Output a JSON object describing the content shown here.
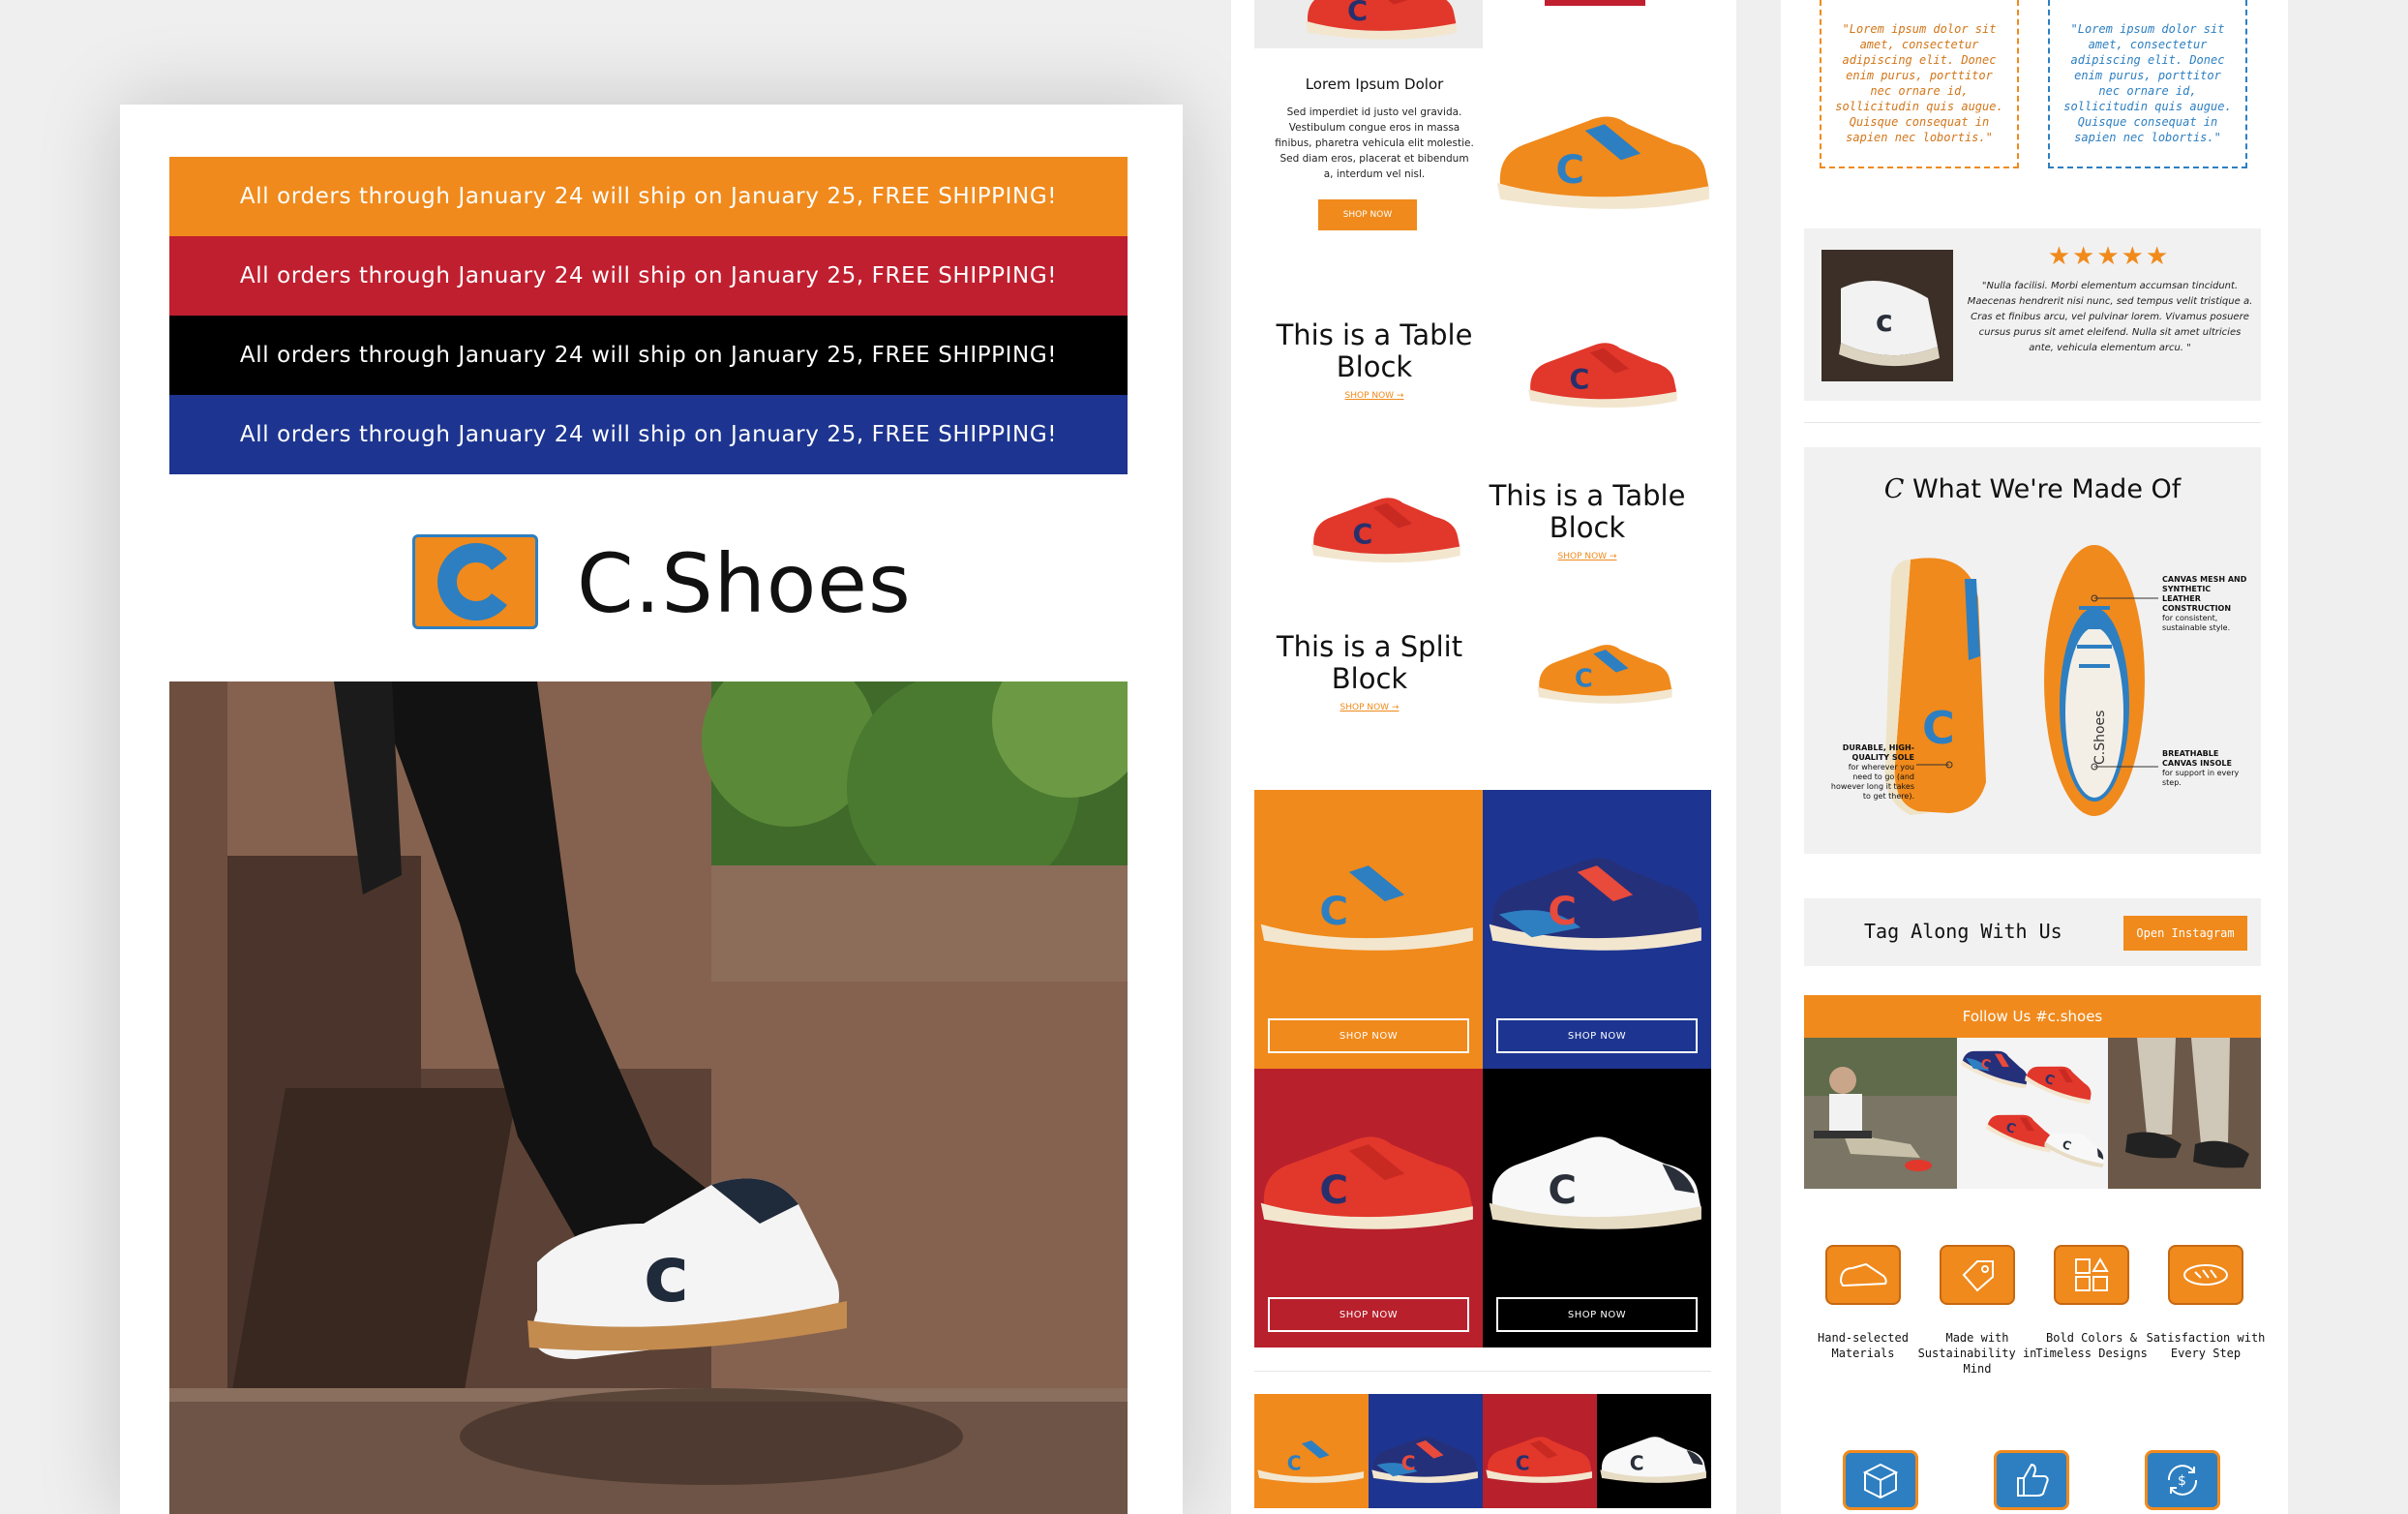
{
  "colors": {
    "orange": "#f08a1c",
    "red": "#c01f2f",
    "black": "#000000",
    "blue": "#1d3590",
    "logo_blue": "#2d7fc1",
    "background": "#efefef"
  },
  "main": {
    "banners": [
      {
        "text": "All orders through January 24 will ship on January 25, FREE SHIPPING!",
        "color": "#f08a1c"
      },
      {
        "text": "All orders through January 24 will ship on January 25, FREE SHIPPING!",
        "color": "#c01f2f"
      },
      {
        "text": "All orders through January 24 will ship on January 25, FREE SHIPPING!",
        "color": "#000000"
      },
      {
        "text": "All orders through January 24 will ship on January 25, FREE SHIPPING!",
        "color": "#1d3590"
      }
    ],
    "logo": {
      "icon": "c-logo-icon",
      "text": "C.Shoes"
    },
    "hero": {
      "icon": "sneaker-photo"
    }
  },
  "middle": {
    "product": {
      "title": "Lorem Ipsum Dolor",
      "body": "Sed imperdiet id justo vel gravida. Vestibulum congue eros in massa finibus, pharetra vehicula elit molestie. Sed diam eros, placerat et bibendum a, interdum vel nisl.",
      "button": "SHOP NOW"
    },
    "table_blocks": [
      {
        "title": "This is a Table Block",
        "link": "SHOP NOW →"
      },
      {
        "title": "This is a Table Block",
        "link": "SHOP NOW →"
      },
      {
        "title": "This is a Split Block",
        "link": "SHOP NOW →"
      }
    ],
    "grid_buttons": [
      "SHOP NOW",
      "SHOP NOW",
      "SHOP NOW",
      "SHOP NOW"
    ]
  },
  "right": {
    "quotes": [
      "\"Lorem ipsum dolor sit amet, consectetur adipiscing elit. Donec enim purus, porttitor nec ornare id, sollicitudin quis augue. Quisque consequat in sapien nec lobortis.\"",
      "\"Lorem ipsum dolor sit amet, consectetur adipiscing elit. Donec enim purus, porttitor nec ornare id, sollicitudin quis augue. Quisque consequat in sapien nec lobortis.\""
    ],
    "review": {
      "stars": "★★★★★",
      "rating": 5,
      "text": "\"Nulla facilisi. Morbi elementum accumsan tincidunt. Maecenas hendrerit nisi nunc, sed tempus velit tristique a. Cras et finibus arcu, vel pulvinar lorem. Vivamus posuere cursus purus sit amet eleifend. Nulla sit amet ultricies ante, vehicula elementum arcu. \""
    },
    "made_of": {
      "title_letter": "C",
      "title": "What We're Made Of",
      "annotations": [
        {
          "head": "CANVAS MESH AND SYNTHETIC LEATHER CONSTRUCTION",
          "body": "for consistent, sustainable style."
        },
        {
          "head": "DURABLE, HIGH-QUALITY SOLE",
          "body": "for wherever you need to go (and however long it takes to get there)."
        },
        {
          "head": "BREATHABLE CANVAS INSOLE",
          "body": "for support in every step."
        }
      ]
    },
    "tag_along": {
      "label": "Tag Along With Us",
      "button": "Open Instagram"
    },
    "follow": {
      "label": "Follow Us #c.shoes"
    },
    "features": [
      {
        "icon": "sneaker-icon",
        "label": "Hand-selected Materials"
      },
      {
        "icon": "eco-tag-icon",
        "label": "Made with Sustainability in Mind"
      },
      {
        "icon": "palette-grid-icon",
        "label": "Bold Colors & Timeless Designs"
      },
      {
        "icon": "shoe-outline-icon",
        "label": "Satisfaction with Every Step"
      }
    ],
    "service_icons": [
      "box-icon",
      "thumbs-up-icon",
      "money-back-icon"
    ]
  }
}
